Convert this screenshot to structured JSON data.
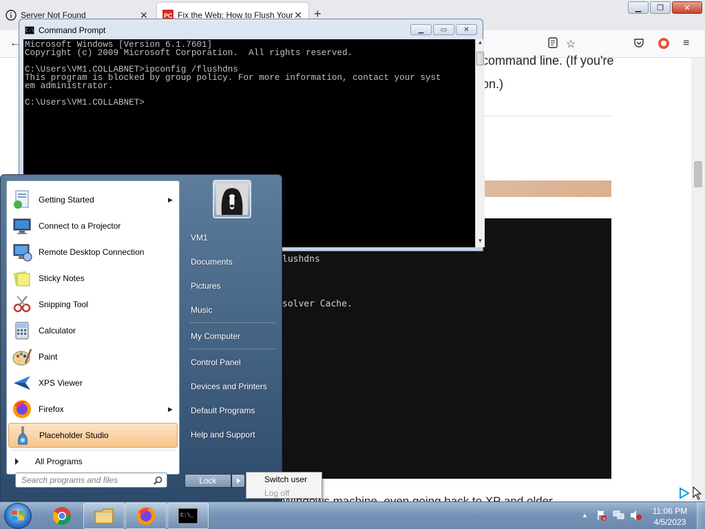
{
  "browser": {
    "tabs": [
      {
        "label": "Server Not Found"
      },
      {
        "label": "Fix the Web: How to Flush Your"
      }
    ],
    "new_tab": "+",
    "article": {
      "line1": "command line. (If you're",
      "line2": "on.)",
      "terminal_line1": "lushdns",
      "terminal_line2": "solver Cache.",
      "bottom_text": "Windows machine, even going back to XP and older"
    }
  },
  "cmd_window": {
    "title": "Command Prompt",
    "lines": [
      "Microsoft Windows [Version 6.1.7601]",
      "Copyright (c) 2009 Microsoft Corporation.  All rights reserved.",
      "",
      "C:\\Users\\VM1.COLLABNET>ipconfig /flushdns",
      "This program is blocked by group policy. For more information, contact your syst",
      "em administrator.",
      "",
      "C:\\Users\\VM1.COLLABNET>"
    ]
  },
  "start_menu": {
    "programs": [
      {
        "label": "Getting Started",
        "icon": "getting-started-icon",
        "submenu": true
      },
      {
        "label": "Connect to a Projector",
        "icon": "projector-icon",
        "submenu": false
      },
      {
        "label": "Remote Desktop Connection",
        "icon": "remote-desktop-icon",
        "submenu": false
      },
      {
        "label": "Sticky Notes",
        "icon": "sticky-notes-icon",
        "submenu": false
      },
      {
        "label": "Snipping Tool",
        "icon": "scissors-icon",
        "submenu": false
      },
      {
        "label": "Calculator",
        "icon": "calculator-icon",
        "submenu": false
      },
      {
        "label": "Paint",
        "icon": "paint-palette-icon",
        "submenu": false
      },
      {
        "label": "XPS Viewer",
        "icon": "xps-viewer-icon",
        "submenu": false
      },
      {
        "label": "Firefox",
        "icon": "firefox-icon",
        "submenu": true
      },
      {
        "label": "Placeholder Studio",
        "icon": "placeholder-studio-icon",
        "submenu": false,
        "highlighted": true
      }
    ],
    "all_programs": "All Programs",
    "search_placeholder": "Search programs and files",
    "right_items": [
      {
        "label": "VM1"
      },
      {
        "label": "Documents"
      },
      {
        "label": "Pictures"
      },
      {
        "label": "Music"
      },
      {
        "label": "My Computer"
      },
      {
        "label": "Control Panel"
      },
      {
        "label": "Devices and Printers"
      },
      {
        "label": "Default Programs"
      },
      {
        "label": "Help and Support"
      }
    ],
    "lock_label": "Lock",
    "power_menu": {
      "switch_user": "Switch user",
      "log_off": "Log off"
    }
  },
  "taskbar": {
    "pinned": [
      "chrome-icon",
      "file-explorer-icon",
      "firefox-icon",
      "command-prompt-icon"
    ],
    "clock_time": "11:06 PM",
    "clock_date": "4/5/2023"
  }
}
